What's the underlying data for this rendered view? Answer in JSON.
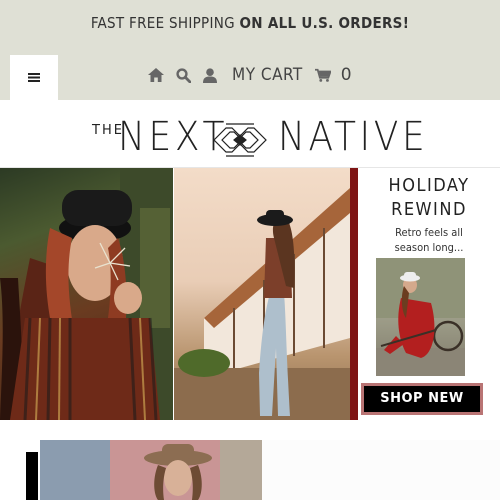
{
  "promo_bar": {
    "text_regular": "FAST FREE SHIPPING ",
    "text_bold": "ON ALL U.S. ORDERS!"
  },
  "header": {
    "menu_icon": "hamburger-icon",
    "icons": [
      "home-icon",
      "search-icon",
      "user-icon",
      "cart-icon"
    ],
    "cart_label": "MY CART",
    "cart_count": "0"
  },
  "logo": {
    "prefix": "THE",
    "word1": "NEXT",
    "word2": "NATIVE"
  },
  "hero": {
    "panel_title_line1": "HOLIDAY",
    "panel_title_line2": "REWIND",
    "panel_subtitle_line1": "Retro feels all",
    "panel_subtitle_line2": "season long...",
    "cta_label": "SHOP NEW"
  },
  "colors": {
    "header_bg": "#dfe0d5",
    "accent_red": "#7e1414",
    "button_outline": "#b97474"
  }
}
